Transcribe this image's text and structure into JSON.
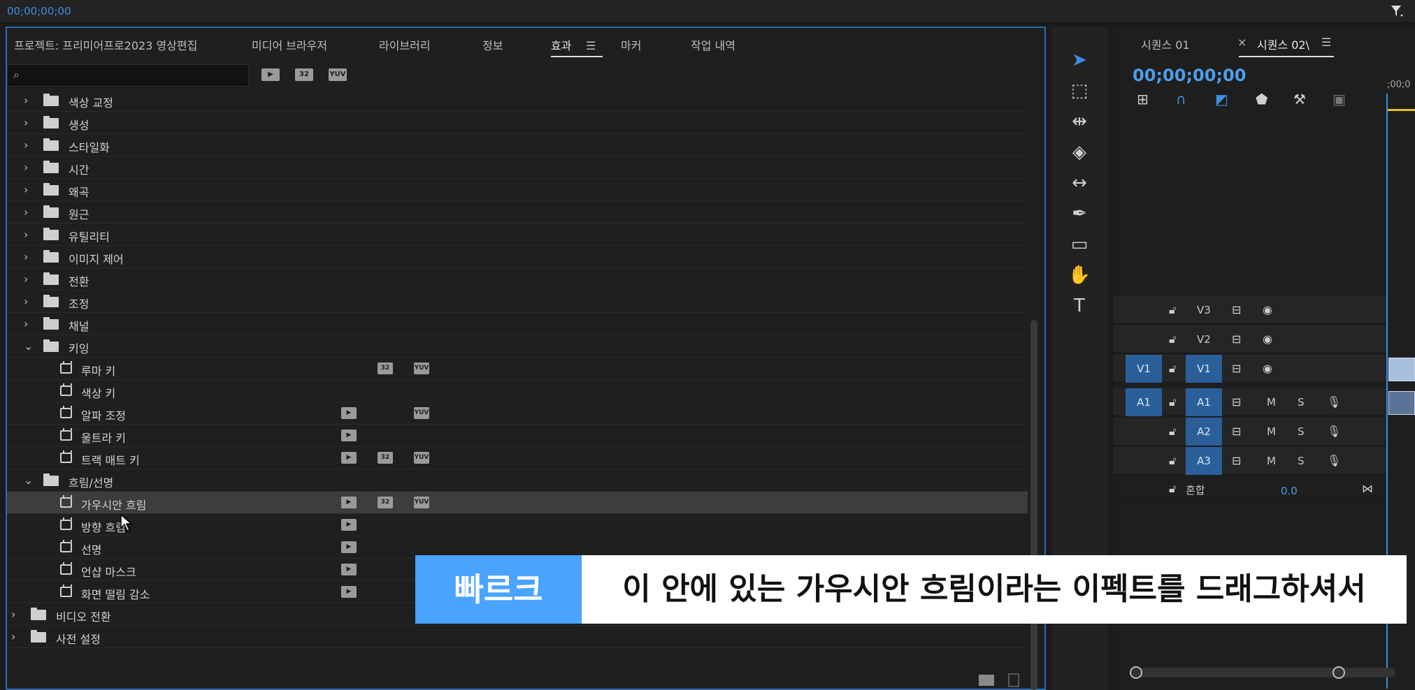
{
  "top_bar": {
    "timecode": "00;00;00;00"
  },
  "effects_panel": {
    "tabs": [
      {
        "label": "프로젝트: 프리미어프로2023 영상편집"
      },
      {
        "label": "미디어 브라우저"
      },
      {
        "label": "라이브러리"
      },
      {
        "label": "정보"
      },
      {
        "label": "효과"
      },
      {
        "label": "마커"
      },
      {
        "label": "작업 내역"
      }
    ],
    "active_tab": "효과",
    "search": {
      "value": "",
      "placeholder": ""
    },
    "filter_badges": [
      "32",
      "YUV"
    ],
    "tree": [
      {
        "label": "색상 교정",
        "type": "folder"
      },
      {
        "label": "생성",
        "type": "folder"
      },
      {
        "label": "스타일화",
        "type": "folder"
      },
      {
        "label": "시간",
        "type": "folder"
      },
      {
        "label": "왜곡",
        "type": "folder"
      },
      {
        "label": "원근",
        "type": "folder"
      },
      {
        "label": "유틸리티",
        "type": "folder"
      },
      {
        "label": "이미지 제어",
        "type": "folder"
      },
      {
        "label": "전환",
        "type": "folder"
      },
      {
        "label": "조정",
        "type": "folder"
      },
      {
        "label": "채널",
        "type": "folder"
      },
      {
        "label": "키잉",
        "type": "folder-open"
      },
      {
        "label": "루마 키",
        "type": "effect"
      },
      {
        "label": "색상 키",
        "type": "effect"
      },
      {
        "label": "알파 조정",
        "type": "effect"
      },
      {
        "label": "울트라 키",
        "type": "effect"
      },
      {
        "label": "트랙 매트 키",
        "type": "effect"
      },
      {
        "label": "흐림/선명",
        "type": "folder-open"
      },
      {
        "label": "가우시안 흐림",
        "type": "effect",
        "selected": true
      },
      {
        "label": "방향 흐림",
        "type": "effect"
      },
      {
        "label": "선명",
        "type": "effect"
      },
      {
        "label": "언샵 마스크",
        "type": "effect"
      },
      {
        "label": "화면 떨림 감소",
        "type": "effect"
      },
      {
        "label": "비디오 전환",
        "type": "folder-root"
      },
      {
        "label": "사전 설정",
        "type": "preset-root"
      }
    ]
  },
  "timeline": {
    "tabs": [
      {
        "label": "시퀀스 01"
      },
      {
        "label": "시퀀스 02\\"
      }
    ],
    "close_glyph": "×",
    "timecode": "00;00;00;00",
    "ruler_label": ";00;0",
    "tracks": {
      "v3": "V3",
      "v2": "V2",
      "v1_src": "V1",
      "v1": "V1",
      "a1_src": "A1",
      "a1": "A1",
      "a2": "A2",
      "a3": "A3",
      "mute": "M",
      "solo": "S",
      "mix_label": "혼합",
      "mix_value": "0.0"
    }
  },
  "subtitle": {
    "speaker": "빠르크",
    "text": "이 안에 있는 가우시안 흐림이라는 이펙트를 드래그하셔서"
  },
  "colors": {
    "accent": "#3d8fe0",
    "speaker_bg": "#4aa3ff",
    "panel_border": "#2d6bb3"
  }
}
